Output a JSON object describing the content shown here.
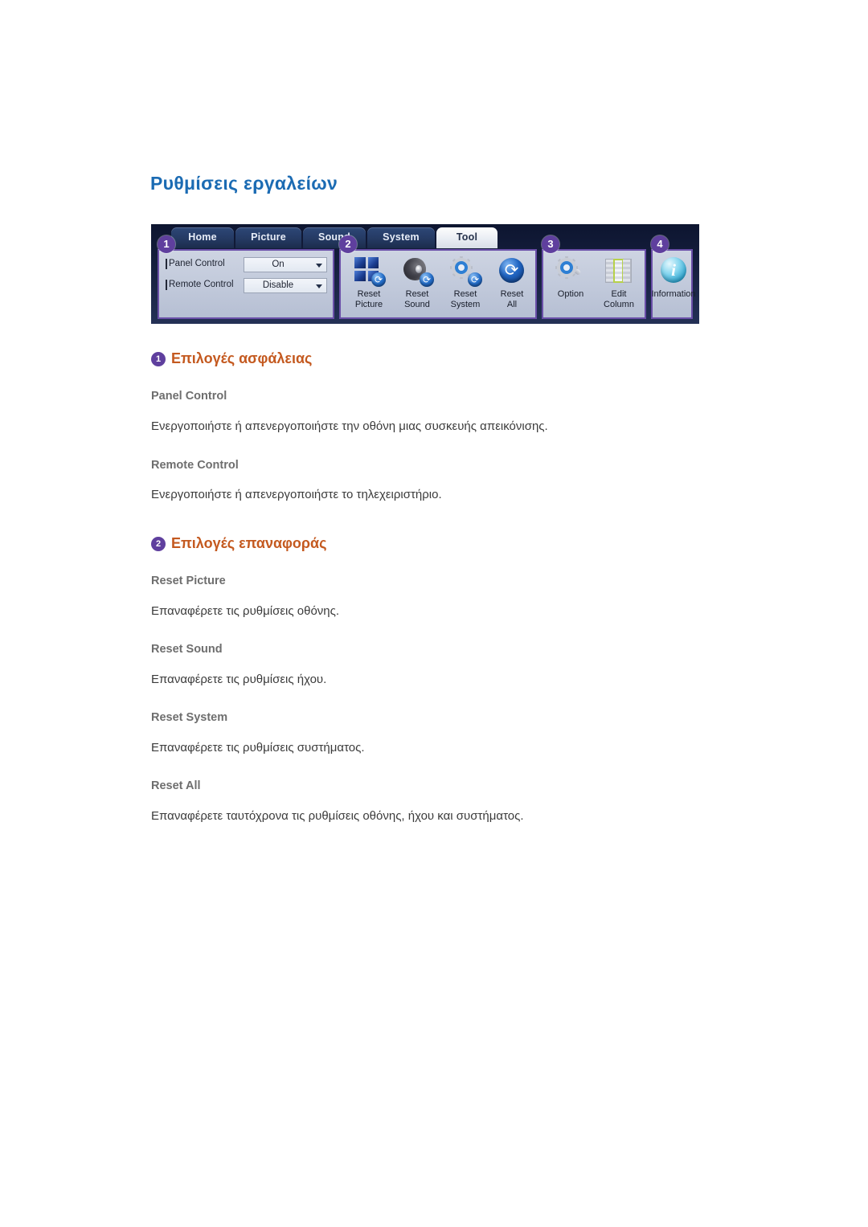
{
  "page": {
    "title": "Ρυθμίσεις εργαλείων",
    "title_color": "#1b6bb3"
  },
  "figure": {
    "tabs": [
      {
        "label": "Home",
        "active": false
      },
      {
        "label": "Picture",
        "active": false
      },
      {
        "label": "Sound",
        "active": false
      },
      {
        "label": "System",
        "active": false
      },
      {
        "label": "Tool",
        "active": true
      }
    ],
    "badges": [
      "1",
      "2",
      "3",
      "4"
    ],
    "group1": {
      "rows": [
        {
          "label": "Panel Control",
          "value": "On"
        },
        {
          "label": "Remote Control",
          "value": "Disable"
        }
      ]
    },
    "group2": {
      "buttons": [
        {
          "caption": "Reset\nPicture",
          "icon": "reset-picture-icon"
        },
        {
          "caption": "Reset\nSound",
          "icon": "reset-sound-icon"
        },
        {
          "caption": "Reset\nSystem",
          "icon": "reset-system-icon"
        },
        {
          "caption": "Reset\nAll",
          "icon": "reset-all-icon"
        }
      ]
    },
    "group3": {
      "buttons": [
        {
          "caption": "Option",
          "icon": "option-gear-wrench-icon"
        },
        {
          "caption": "Edit\nColumn",
          "icon": "edit-column-icon"
        }
      ]
    },
    "group4": {
      "buttons": [
        {
          "caption": "Information",
          "icon": "information-icon"
        }
      ]
    },
    "frame_color": "#6a4fa8"
  },
  "sections": [
    {
      "badge": "1",
      "heading": "Επιλογές ασφάλειας",
      "items": [
        {
          "title": "Panel Control",
          "text": "Ενεργοποιήστε ή απενεργοποιήστε την οθόνη μιας συσκευής απεικόνισης."
        },
        {
          "title": "Remote Control",
          "text": "Ενεργοποιήστε ή απενεργοποιήστε το τηλεχειριστήριο."
        }
      ]
    },
    {
      "badge": "2",
      "heading": "Επιλογές επαναφοράς",
      "items": [
        {
          "title": "Reset Picture",
          "text": "Επαναφέρετε τις ρυθμίσεις οθόνης."
        },
        {
          "title": "Reset Sound",
          "text": "Επαναφέρετε τις ρυθμίσεις ήχου."
        },
        {
          "title": "Reset System",
          "text": "Επαναφέρετε τις ρυθμίσεις συστήματος."
        },
        {
          "title": "Reset All",
          "text": "Επαναφέρετε ταυτόχρονα τις ρυθμίσεις οθόνης, ήχου και συστήματος."
        }
      ]
    }
  ],
  "colors": {
    "heading_orange": "#c4591f",
    "badge_purple": "#5f3f9e",
    "subhead_gray": "#6e6e6e",
    "body_gray": "#3b3b3b"
  }
}
